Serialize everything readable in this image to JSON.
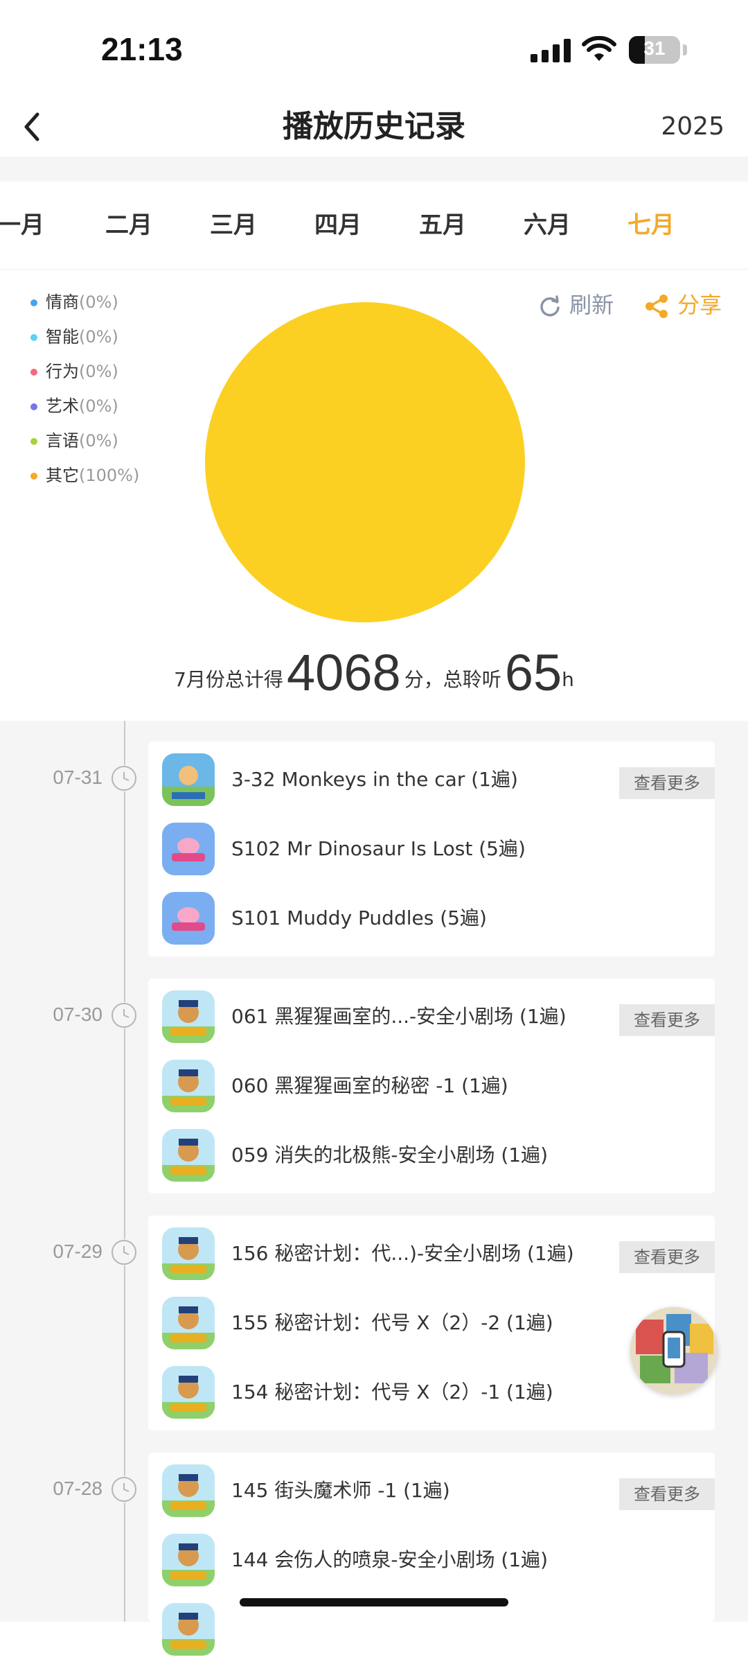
{
  "status_bar": {
    "time": "21:13",
    "battery": "31",
    "battery_level": 0.31
  },
  "nav": {
    "title": "播放历史记录",
    "year": "2025"
  },
  "months": [
    {
      "label": "一月",
      "active": false
    },
    {
      "label": "二月",
      "active": false
    },
    {
      "label": "三月",
      "active": false
    },
    {
      "label": "四月",
      "active": false
    },
    {
      "label": "五月",
      "active": false
    },
    {
      "label": "六月",
      "active": false
    },
    {
      "label": "七月",
      "active": true
    }
  ],
  "legend": [
    {
      "label": "情商",
      "percent": "(0%)",
      "color": "#4aa3e8"
    },
    {
      "label": "智能",
      "percent": "(0%)",
      "color": "#5ed1f0"
    },
    {
      "label": "行为",
      "percent": "(0%)",
      "color": "#f06b7d"
    },
    {
      "label": "艺术",
      "percent": "(0%)",
      "color": "#7b74e8"
    },
    {
      "label": "言语",
      "percent": "(0%)",
      "color": "#a8d23c"
    },
    {
      "label": "其它",
      "percent": "(100%)",
      "color": "#f4a92a"
    }
  ],
  "actions": {
    "refresh": "刷新",
    "share": "分享"
  },
  "chart_data": {
    "type": "pie",
    "labels": [
      "情商",
      "智能",
      "行为",
      "艺术",
      "言语",
      "其它"
    ],
    "values": [
      0,
      0,
      0,
      0,
      0,
      100
    ],
    "colors": [
      "#4aa3e8",
      "#5ed1f0",
      "#f06b7d",
      "#7b74e8",
      "#a8d23c",
      "#fcd022"
    ]
  },
  "summary": {
    "prefix": "7月份总计得",
    "score": "4068",
    "score_unit": "分，总聆听",
    "hours": "65",
    "hours_unit": "h"
  },
  "more_label": "查看更多",
  "days": [
    {
      "date": "07-31",
      "items": [
        {
          "title": "3-32 Monkeys in the car (1遍)",
          "icon": "oxford-reading-tree-icon"
        },
        {
          "title": "S102 Mr Dinosaur Is Lost (5遍)",
          "icon": "peppa-pig-icon"
        },
        {
          "title": "S101 Muddy Puddles (5遍)",
          "icon": "peppa-pig-icon"
        }
      ]
    },
    {
      "date": "07-30",
      "items": [
        {
          "title": "061 黑猩猩画室的...-安全小剧场 (1遍)",
          "icon": "police-chief-icon"
        },
        {
          "title": "060 黑猩猩画室的秘密 -1 (1遍)",
          "icon": "police-chief-icon"
        },
        {
          "title": "059 消失的北极熊-安全小剧场 (1遍)",
          "icon": "police-chief-icon"
        }
      ]
    },
    {
      "date": "07-29",
      "items": [
        {
          "title": "156 秘密计划：代...)-安全小剧场 (1遍)",
          "icon": "police-chief-icon"
        },
        {
          "title": "155 秘密计划：代号 X（2）-2 (1遍)",
          "icon": "police-chief-icon"
        },
        {
          "title": "154 秘密计划：代号 X（2）-1 (1遍)",
          "icon": "police-chief-icon"
        }
      ]
    },
    {
      "date": "07-28",
      "items": [
        {
          "title": "145 街头魔术师 -1 (1遍)",
          "icon": "police-chief-icon"
        },
        {
          "title": "144 会伤人的喷泉-安全小剧场 (1遍)",
          "icon": "police-chief-icon"
        },
        {
          "title": "",
          "icon": "police-chief-icon"
        }
      ]
    }
  ]
}
